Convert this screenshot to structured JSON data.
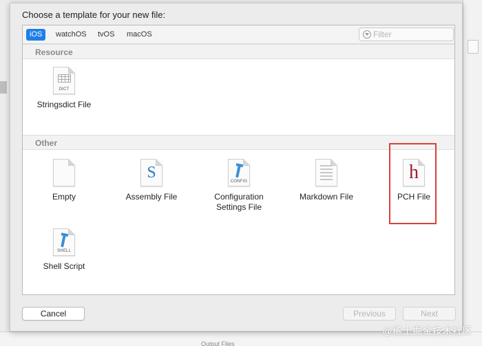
{
  "dialog": {
    "prompt": "Choose a template for your new file:"
  },
  "tabs": [
    {
      "label": "iOS",
      "selected": true
    },
    {
      "label": "watchOS",
      "selected": false
    },
    {
      "label": "tvOS",
      "selected": false
    },
    {
      "label": "macOS",
      "selected": false
    }
  ],
  "filter": {
    "placeholder": "Filter",
    "value": ""
  },
  "sections": [
    {
      "title": "Resource",
      "items": [
        {
          "label": "Stringsdict File",
          "icon": "stringsdict-file-icon",
          "tag": "DICT"
        }
      ]
    },
    {
      "title": "Other",
      "items": [
        {
          "label": "Empty",
          "icon": "empty-file-icon"
        },
        {
          "label": "Assembly File",
          "icon": "assembly-file-icon",
          "glyph": "S"
        },
        {
          "label": "Configuration Settings File",
          "icon": "config-file-icon",
          "tag": "CONFIG"
        },
        {
          "label": "Markdown File",
          "icon": "markdown-file-icon"
        },
        {
          "label": "PCH File",
          "icon": "pch-file-icon",
          "glyph": "h",
          "highlighted": true
        },
        {
          "label": "Shell Script",
          "icon": "shell-script-icon",
          "tag": "SHELL"
        }
      ]
    }
  ],
  "buttons": {
    "cancel": "Cancel",
    "previous": "Previous",
    "next": "Next"
  },
  "background": {
    "bottom_label": "Output Files",
    "watermark": "@稀土掘金技术社区"
  },
  "colors": {
    "selected_tab": "#1f7fe8",
    "highlight_border": "#d9403a",
    "pch_glyph": "#9c1c2c",
    "assembly_glyph": "#2f7bc4"
  }
}
